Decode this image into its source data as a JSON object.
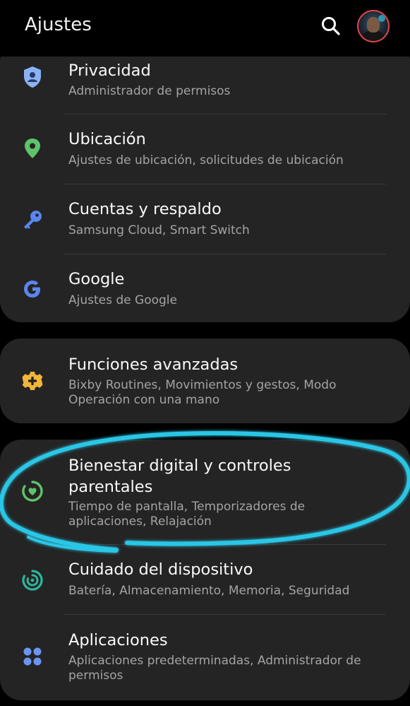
{
  "header": {
    "title": "Ajustes",
    "search_icon": "search-icon",
    "avatar": "profile-avatar"
  },
  "colors": {
    "background": "#000000",
    "card": "#242424",
    "highlight": "#29c6e6",
    "avatar_ring": "#e0454a"
  },
  "groups": [
    {
      "items": [
        {
          "icon": "shield-person-icon",
          "title": "Privacidad",
          "subtitle": "Administrador de permisos"
        },
        {
          "icon": "location-pin-icon",
          "title": "Ubicación",
          "subtitle": "Ajustes de ubicación, solicitudes de ubicación"
        },
        {
          "icon": "key-icon",
          "title": "Cuentas y respaldo",
          "subtitle": "Samsung Cloud, Smart Switch"
        },
        {
          "icon": "google-icon",
          "title": "Google",
          "subtitle": "Ajustes de Google"
        }
      ]
    },
    {
      "items": [
        {
          "icon": "gear-plus-icon",
          "title": "Funciones avanzadas",
          "subtitle": "Bixby Routines, Movimientos y gestos, Modo Operación con una mano"
        }
      ]
    },
    {
      "items": [
        {
          "icon": "wellbeing-heart-icon",
          "title": "Bienestar digital y controles parentales",
          "subtitle": "Tiempo de pantalla, Temporizadores de aplicaciones, Relajación",
          "highlighted": true
        },
        {
          "icon": "device-care-icon",
          "title": "Cuidado del dispositivo",
          "subtitle": "Batería, Almacenamiento, Memoria, Seguridad"
        },
        {
          "icon": "apps-grid-icon",
          "title": "Aplicaciones",
          "subtitle": "Aplicaciones predeterminadas, Administrador de permisos"
        }
      ]
    }
  ]
}
